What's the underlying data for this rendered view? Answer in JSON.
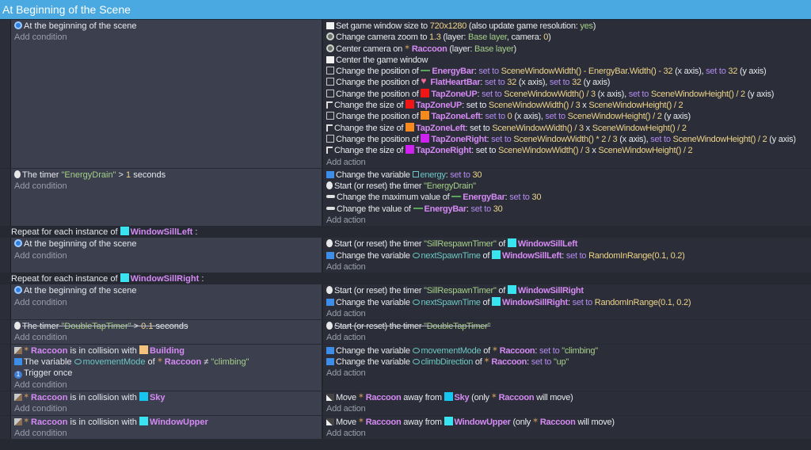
{
  "header": {
    "title": "At Beginning of the Scene"
  },
  "labels": {
    "add_condition": "Add condition",
    "add_action": "Add action"
  },
  "events": [
    {
      "conditions": [
        [
          [
            "i",
            "begin"
          ],
          [
            "p",
            "At the beginning of the scene"
          ]
        ]
      ],
      "actions": [
        [
          [
            "i",
            "window"
          ],
          [
            "p",
            "Set game window size to "
          ],
          [
            "n",
            "720x1280"
          ],
          [
            "p",
            " (also update game resolution: "
          ],
          [
            "s",
            "yes"
          ],
          [
            "p",
            ")"
          ]
        ],
        [
          [
            "i",
            "camera"
          ],
          [
            "p",
            "Change camera zoom to "
          ],
          [
            "n",
            "1.3"
          ],
          [
            "p",
            " (layer: "
          ],
          [
            "s",
            "Base layer"
          ],
          [
            "p",
            ", camera: "
          ],
          [
            "n",
            "0"
          ],
          [
            "p",
            ")"
          ]
        ],
        [
          [
            "i",
            "camera"
          ],
          [
            "p",
            "Center camera on "
          ],
          [
            "i",
            "raccoon"
          ],
          [
            "o",
            "Raccoon"
          ],
          [
            "p",
            " (layer: "
          ],
          [
            "s",
            "Base layer"
          ],
          [
            "p",
            ")"
          ]
        ],
        [
          [
            "i",
            "window"
          ],
          [
            "p",
            "Center the game window"
          ]
        ],
        [
          [
            "i",
            "position"
          ],
          [
            "p",
            "Change the position of "
          ],
          [
            "i",
            "energybar"
          ],
          [
            "o",
            "EnergyBar"
          ],
          [
            "p",
            ": "
          ],
          [
            "k",
            "set to"
          ],
          [
            "p",
            " "
          ],
          [
            "n",
            "SceneWindowWidth() - EnergyBar.Width() - 32"
          ],
          [
            "p",
            " (x axis), "
          ],
          [
            "k",
            "set to"
          ],
          [
            "p",
            " "
          ],
          [
            "n",
            "32"
          ],
          [
            "p",
            " (y axis)"
          ]
        ],
        [
          [
            "i",
            "position"
          ],
          [
            "p",
            "Change the position of "
          ],
          [
            "i",
            "heart"
          ],
          [
            "o",
            "FlatHeartBar"
          ],
          [
            "p",
            ": "
          ],
          [
            "k",
            "set to"
          ],
          [
            "p",
            " "
          ],
          [
            "n",
            "32"
          ],
          [
            "p",
            " (x axis), "
          ],
          [
            "k",
            "set to"
          ],
          [
            "p",
            " "
          ],
          [
            "n",
            "32"
          ],
          [
            "p",
            " (y axis)"
          ]
        ],
        [
          [
            "i",
            "position"
          ],
          [
            "p",
            "Change the position of "
          ],
          [
            "i",
            "red"
          ],
          [
            "o",
            "TapZoneUP"
          ],
          [
            "p",
            ": "
          ],
          [
            "k",
            "set to"
          ],
          [
            "p",
            " "
          ],
          [
            "n",
            "SceneWindowWidth() / 3"
          ],
          [
            "p",
            " (x axis), "
          ],
          [
            "k",
            "set to"
          ],
          [
            "p",
            " "
          ],
          [
            "n",
            "SceneWindowHeight() / 2"
          ],
          [
            "p",
            " (y axis)"
          ]
        ],
        [
          [
            "i",
            "size"
          ],
          [
            "p",
            "Change the size of "
          ],
          [
            "i",
            "red"
          ],
          [
            "o",
            "TapZoneUP"
          ],
          [
            "p",
            ": set to "
          ],
          [
            "n",
            "SceneWindowWidth() / 3"
          ],
          [
            "p",
            " x "
          ],
          [
            "n",
            "SceneWindowHeight() / 2"
          ]
        ],
        [
          [
            "i",
            "position"
          ],
          [
            "p",
            "Change the position of "
          ],
          [
            "i",
            "orange"
          ],
          [
            "o",
            "TapZoneLeft"
          ],
          [
            "p",
            ": "
          ],
          [
            "k",
            "set to"
          ],
          [
            "p",
            " "
          ],
          [
            "n",
            "0"
          ],
          [
            "p",
            " (x axis), "
          ],
          [
            "k",
            "set to"
          ],
          [
            "p",
            " "
          ],
          [
            "n",
            "SceneWindowHeight() / 2"
          ],
          [
            "p",
            " (y axis)"
          ]
        ],
        [
          [
            "i",
            "size"
          ],
          [
            "p",
            "Change the size of "
          ],
          [
            "i",
            "orange"
          ],
          [
            "o",
            "TapZoneLeft"
          ],
          [
            "p",
            ": set to "
          ],
          [
            "n",
            "SceneWindowWidth() / 3"
          ],
          [
            "p",
            " x "
          ],
          [
            "n",
            "SceneWindowHeight() / 2"
          ]
        ],
        [
          [
            "i",
            "position"
          ],
          [
            "p",
            "Change the position of "
          ],
          [
            "i",
            "magenta"
          ],
          [
            "o",
            "TapZoneRight"
          ],
          [
            "p",
            ": "
          ],
          [
            "k",
            "set to"
          ],
          [
            "p",
            " "
          ],
          [
            "n",
            "SceneWindowWidth() * 2 / 3"
          ],
          [
            "p",
            " (x axis), "
          ],
          [
            "k",
            "set to"
          ],
          [
            "p",
            " "
          ],
          [
            "n",
            "SceneWindowHeight() / 2"
          ],
          [
            "p",
            " (y axis)"
          ]
        ],
        [
          [
            "i",
            "size"
          ],
          [
            "p",
            "Change the size of "
          ],
          [
            "i",
            "magenta"
          ],
          [
            "o",
            "TapZoneRight"
          ],
          [
            "p",
            ": set to "
          ],
          [
            "n",
            "SceneWindowWidth() / 3"
          ],
          [
            "p",
            " x "
          ],
          [
            "n",
            "SceneWindowHeight() / 2"
          ]
        ]
      ]
    },
    {
      "conditions": [
        [
          [
            "i",
            "timer"
          ],
          [
            "p",
            "The timer "
          ],
          [
            "s",
            "\"EnergyDrain\""
          ],
          [
            "p",
            " > "
          ],
          [
            "n",
            "1"
          ],
          [
            "p",
            " seconds"
          ]
        ]
      ],
      "actions": [
        [
          [
            "i",
            "variable"
          ],
          [
            "p",
            "Change the variable "
          ],
          [
            "i",
            "varglobal"
          ],
          [
            "v",
            "energy"
          ],
          [
            "p",
            ": "
          ],
          [
            "k",
            "set to"
          ],
          [
            "p",
            " "
          ],
          [
            "n",
            "30"
          ]
        ],
        [
          [
            "i",
            "timer"
          ],
          [
            "p",
            "Start (or reset) the timer "
          ],
          [
            "s",
            "\"EnergyDrain\""
          ]
        ],
        [
          [
            "i",
            "bar"
          ],
          [
            "p",
            "Change the maximum value of "
          ],
          [
            "i",
            "energybar"
          ],
          [
            "o",
            "EnergyBar"
          ],
          [
            "p",
            ": "
          ],
          [
            "k",
            "set to"
          ],
          [
            "p",
            " "
          ],
          [
            "n",
            "30"
          ]
        ],
        [
          [
            "i",
            "bar"
          ],
          [
            "p",
            "Change the value of "
          ],
          [
            "i",
            "energybar"
          ],
          [
            "o",
            "EnergyBar"
          ],
          [
            "p",
            ": "
          ],
          [
            "k",
            "set to"
          ],
          [
            "p",
            " "
          ],
          [
            "n",
            "30"
          ]
        ]
      ]
    },
    {
      "repeat": [
        [
          "p",
          "Repeat for each instance of "
        ],
        [
          "i",
          "cyan"
        ],
        [
          "o",
          "WindowSillLeft"
        ],
        [
          "p",
          " :"
        ]
      ],
      "conditions": [
        [
          [
            "i",
            "begin"
          ],
          [
            "p",
            "At the beginning of the scene"
          ]
        ]
      ],
      "actions": [
        [
          [
            "i",
            "timer"
          ],
          [
            "p",
            "Start (or reset) the timer "
          ],
          [
            "s",
            "\"SillRespawnTimer\""
          ],
          [
            "p",
            " of "
          ],
          [
            "i",
            "cyan"
          ],
          [
            "o",
            "WindowSillLeft"
          ]
        ],
        [
          [
            "i",
            "variable"
          ],
          [
            "p",
            "Change the variable "
          ],
          [
            "i",
            "varobj"
          ],
          [
            "v",
            "nextSpawnTime"
          ],
          [
            "p",
            " of "
          ],
          [
            "i",
            "cyan"
          ],
          [
            "o",
            "WindowSillLeft"
          ],
          [
            "p",
            ": "
          ],
          [
            "k",
            "set to"
          ],
          [
            "p",
            " "
          ],
          [
            "n",
            "RandomInRange(0.1, 0.2)"
          ]
        ]
      ]
    },
    {
      "repeat": [
        [
          "p",
          "Repeat for each instance of "
        ],
        [
          "i",
          "cyan"
        ],
        [
          "o",
          "WindowSillRight"
        ],
        [
          "p",
          " :"
        ]
      ],
      "conditions": [
        [
          [
            "i",
            "begin"
          ],
          [
            "p",
            "At the beginning of the scene"
          ]
        ]
      ],
      "actions": [
        [
          [
            "i",
            "timer"
          ],
          [
            "p",
            "Start (or reset) the timer "
          ],
          [
            "s",
            "\"SillRespawnTimer\""
          ],
          [
            "p",
            " of "
          ],
          [
            "i",
            "cyan"
          ],
          [
            "o",
            "WindowSillRight"
          ]
        ],
        [
          [
            "i",
            "variable"
          ],
          [
            "p",
            "Change the variable "
          ],
          [
            "i",
            "varobj"
          ],
          [
            "v",
            "nextSpawnTime"
          ],
          [
            "p",
            " of "
          ],
          [
            "i",
            "cyan"
          ],
          [
            "o",
            "WindowSillRight"
          ],
          [
            "p",
            ": "
          ],
          [
            "k",
            "set to"
          ],
          [
            "p",
            " "
          ],
          [
            "n",
            "RandomInRange(0.1, 0.2)"
          ]
        ]
      ]
    },
    {
      "disabled": true,
      "conditions": [
        [
          [
            "i",
            "timer"
          ],
          [
            "p",
            "The timer "
          ],
          [
            "s",
            "\"DoubleTapTimer\""
          ],
          [
            "p",
            " > "
          ],
          [
            "n",
            "0.1"
          ],
          [
            "p",
            " seconds"
          ]
        ]
      ],
      "actions": [
        [
          [
            "i",
            "timer"
          ],
          [
            "p",
            "Start (or reset) the timer "
          ],
          [
            "s",
            "\"DoubleTapTimer\""
          ]
        ]
      ]
    },
    {
      "conditions": [
        [
          [
            "i",
            "collision"
          ],
          [
            "i",
            "raccoon"
          ],
          [
            "o",
            "Raccoon"
          ],
          [
            "p",
            " is in collision with "
          ],
          [
            "i",
            "building"
          ],
          [
            "o",
            "Building"
          ]
        ],
        [
          [
            "i",
            "variable"
          ],
          [
            "p",
            "The variable "
          ],
          [
            "i",
            "varobj"
          ],
          [
            "v",
            "movementMode"
          ],
          [
            "p",
            " of "
          ],
          [
            "i",
            "raccoon"
          ],
          [
            "o",
            "Raccoon"
          ],
          [
            "p",
            " ≠ "
          ],
          [
            "s",
            "\"climbing\""
          ]
        ],
        [
          [
            "i",
            "once"
          ],
          [
            "p",
            "Trigger once"
          ]
        ]
      ],
      "actions": [
        [
          [
            "i",
            "variable"
          ],
          [
            "p",
            "Change the variable "
          ],
          [
            "i",
            "varobj"
          ],
          [
            "v",
            "movementMode"
          ],
          [
            "p",
            " of "
          ],
          [
            "i",
            "raccoon"
          ],
          [
            "o",
            "Raccoon"
          ],
          [
            "p",
            ": "
          ],
          [
            "k",
            "set to"
          ],
          [
            "p",
            " "
          ],
          [
            "s",
            "\"climbing\""
          ]
        ],
        [
          [
            "i",
            "variable"
          ],
          [
            "p",
            "Change the variable "
          ],
          [
            "i",
            "varobj"
          ],
          [
            "v",
            "climbDirection"
          ],
          [
            "p",
            " of "
          ],
          [
            "i",
            "raccoon"
          ],
          [
            "o",
            "Raccoon"
          ],
          [
            "p",
            ": "
          ],
          [
            "k",
            "set to"
          ],
          [
            "p",
            " "
          ],
          [
            "s",
            "\"up\""
          ]
        ]
      ]
    },
    {
      "conditions": [
        [
          [
            "i",
            "collision"
          ],
          [
            "i",
            "raccoon"
          ],
          [
            "o",
            "Raccoon"
          ],
          [
            "p",
            " is in collision with "
          ],
          [
            "i",
            "sky"
          ],
          [
            "o",
            "Sky"
          ]
        ]
      ],
      "actions": [
        [
          [
            "i",
            "move"
          ],
          [
            "p",
            "Move "
          ],
          [
            "i",
            "raccoon"
          ],
          [
            "o",
            "Raccoon"
          ],
          [
            "p",
            " away from "
          ],
          [
            "i",
            "sky"
          ],
          [
            "o",
            "Sky"
          ],
          [
            "p",
            " (only "
          ],
          [
            "i",
            "raccoon"
          ],
          [
            "o",
            "Raccoon"
          ],
          [
            "p",
            " will move)"
          ]
        ]
      ]
    },
    {
      "conditions": [
        [
          [
            "i",
            "collision"
          ],
          [
            "i",
            "raccoon"
          ],
          [
            "o",
            "Raccoon"
          ],
          [
            "p",
            " is in collision with "
          ],
          [
            "i",
            "cyan"
          ],
          [
            "o",
            "WindowUpper"
          ]
        ]
      ],
      "actions": [
        [
          [
            "i",
            "move"
          ],
          [
            "p",
            "Move "
          ],
          [
            "i",
            "raccoon"
          ],
          [
            "o",
            "Raccoon"
          ],
          [
            "p",
            " away from "
          ],
          [
            "i",
            "cyan"
          ],
          [
            "o",
            "WindowUpper"
          ],
          [
            "p",
            " (only "
          ],
          [
            "i",
            "raccoon"
          ],
          [
            "o",
            "Raccoon"
          ],
          [
            "p",
            " will move)"
          ]
        ]
      ]
    }
  ]
}
